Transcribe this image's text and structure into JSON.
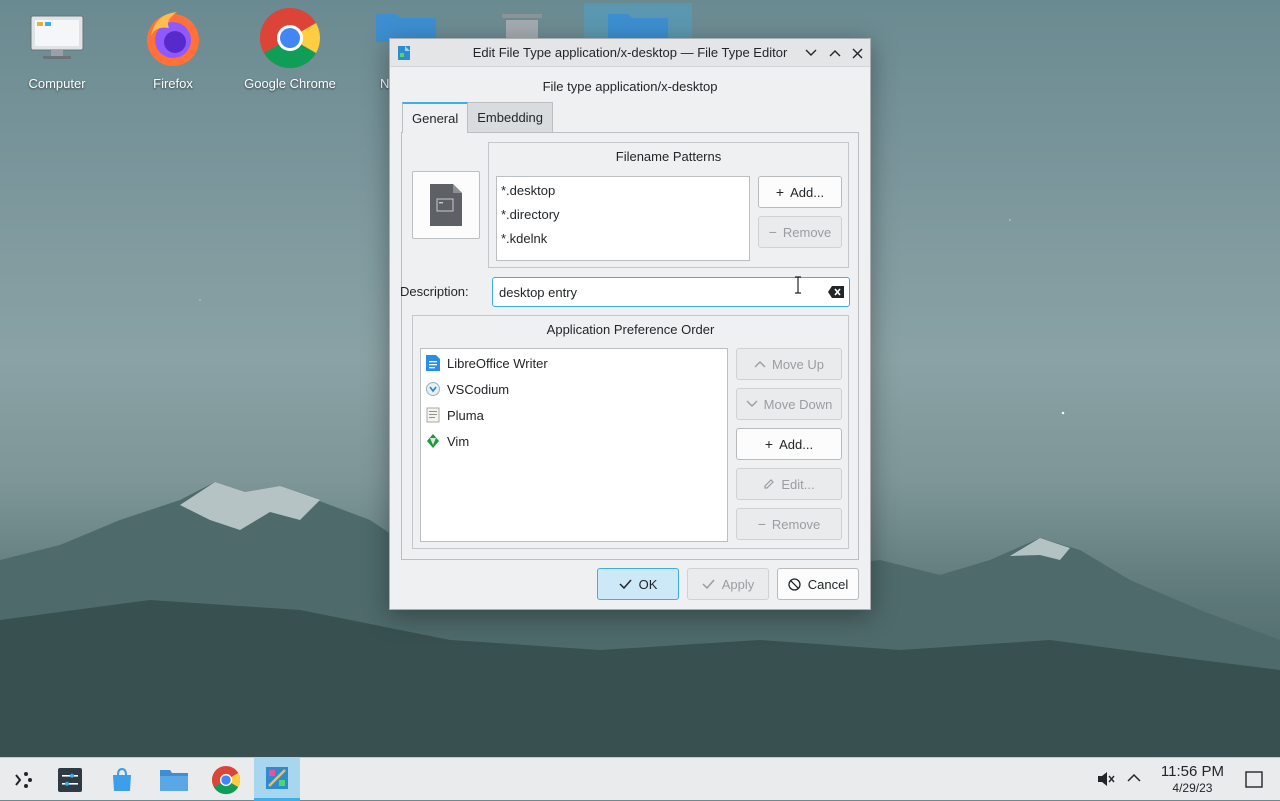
{
  "desktop": {
    "icons": [
      {
        "label": "Computer"
      },
      {
        "label": "Firefox"
      },
      {
        "label": "Google Chrome"
      },
      {
        "label": "N"
      }
    ]
  },
  "dialog": {
    "title": "Edit File Type application/x-desktop — File Type Editor",
    "subtitle": "File type application/x-desktop",
    "tabs": [
      {
        "label": "General",
        "active": true
      },
      {
        "label": "Embedding",
        "active": false
      }
    ],
    "filename_patterns": {
      "title": "Filename Patterns",
      "items": [
        "*.desktop",
        "*.directory",
        "*.kdelnk"
      ],
      "add_label": "Add...",
      "remove_label": "Remove"
    },
    "description": {
      "label": "Description:",
      "value": "desktop entry"
    },
    "app_preference": {
      "title": "Application Preference Order",
      "items": [
        {
          "name": "LibreOffice Writer",
          "icon": "libreoffice-writer-icon"
        },
        {
          "name": "VSCodium",
          "icon": "vscodium-icon"
        },
        {
          "name": "Pluma",
          "icon": "pluma-icon"
        },
        {
          "name": "Vim",
          "icon": "vim-icon"
        }
      ],
      "move_up_label": "Move Up",
      "move_down_label": "Move Down",
      "add_label": "Add...",
      "edit_label": "Edit...",
      "remove_label": "Remove"
    },
    "buttons": {
      "ok": "OK",
      "apply": "Apply",
      "cancel": "Cancel"
    }
  },
  "taskbar": {
    "time": "11:56 PM",
    "date": "4/29/23"
  },
  "colors": {
    "accent": "#3daee9",
    "window_bg": "#eff0f1",
    "panel_bg": "#e9ebed"
  }
}
